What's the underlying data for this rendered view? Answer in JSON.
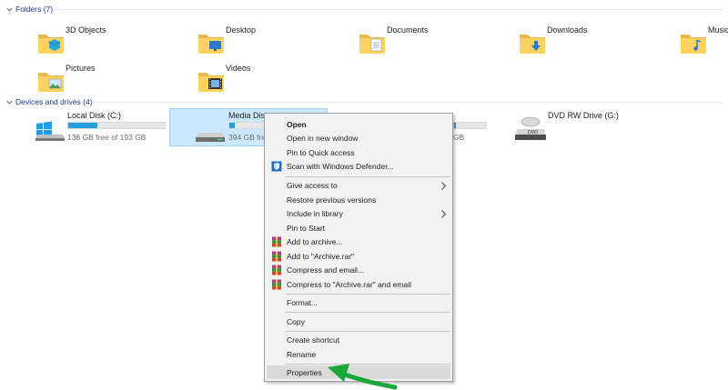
{
  "folders_header": {
    "label": "Folders (7)"
  },
  "folders": [
    {
      "label": "3D Objects",
      "icon": "3d-objects-folder-icon"
    },
    {
      "label": "Desktop",
      "icon": "desktop-folder-icon"
    },
    {
      "label": "Documents",
      "icon": "documents-folder-icon"
    },
    {
      "label": "Downloads",
      "icon": "downloads-folder-icon"
    },
    {
      "label": "Music",
      "icon": "music-folder-icon"
    },
    {
      "label": "Pictures",
      "icon": "pictures-folder-icon"
    },
    {
      "label": "Videos",
      "icon": "videos-folder-icon"
    }
  ],
  "drives_header": {
    "label": "Devices and drives (4)"
  },
  "drives": [
    {
      "name": "Local Disk (C:)",
      "free": "136 GB free of 193 GB",
      "used_fraction": 0.3,
      "icon": "windows-drive-icon"
    },
    {
      "name": "Media Disk",
      "free": "394 GB fre",
      "used_fraction": 0.06,
      "icon": "hard-drive-icon",
      "selected": true
    },
    {
      "name": "",
      "free": "GB",
      "used_fraction": 0.05,
      "icon": "hard-drive-icon"
    },
    {
      "name": "DVD RW Drive (G:)",
      "free": "",
      "icon": "dvd-drive-icon"
    }
  ],
  "context_menu": {
    "items": [
      {
        "label": "Open",
        "bold": true
      },
      {
        "label": "Open in new window"
      },
      {
        "label": "Pin to Quick access"
      },
      {
        "label": "Scan with Windows Defender...",
        "icon": "windows-defender-icon"
      },
      {
        "label": "Give access to",
        "submenu": true
      },
      {
        "label": "Restore previous versions"
      },
      {
        "label": "Include in library",
        "submenu": true
      },
      {
        "label": "Pin to Start"
      },
      {
        "label": "Add to archive...",
        "icon": "winrar-icon"
      },
      {
        "label": "Add to \"Archive.rar\"",
        "icon": "winrar-icon"
      },
      {
        "label": "Compress and email...",
        "icon": "winrar-icon"
      },
      {
        "label": "Compress to \"Archive.rar\" and email",
        "icon": "winrar-icon"
      },
      {
        "label": "Format..."
      },
      {
        "label": "Copy"
      },
      {
        "label": "Create shortcut"
      },
      {
        "label": "Rename"
      },
      {
        "label": "Properties",
        "highlighted": true
      }
    ]
  },
  "colors": {
    "group_header": "#1e3287",
    "selection_bg": "#cce8ff",
    "selection_border": "#99d1ff",
    "drive_bar": "#26a0da",
    "menu_bg": "#f2f2f2",
    "menu_hover": "#dadada",
    "annotation_arrow": "#1aa83a"
  }
}
